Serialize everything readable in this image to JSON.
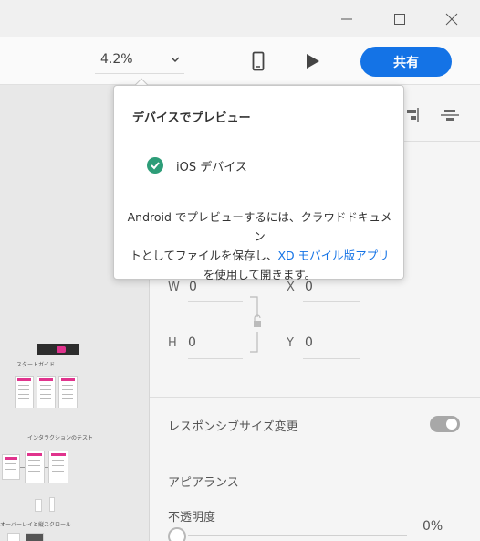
{
  "toolbar": {
    "zoom": "4.2%",
    "share_label": "共有"
  },
  "canvas": {
    "artboard_1_title": "スタートガイド",
    "artboard_2_title": "インタラクションのテスト",
    "artboard_3_title": "オーバーレイと縦スクロール"
  },
  "popover": {
    "title": "デバイスでプレビュー",
    "device_label": "iOS デバイス",
    "message_line1": "Android でプレビューするには、クラウドドキュメン",
    "message_line2_prefix": "トとしてファイルを保存し、",
    "message_link": "XD モバイル版アプリ",
    "message_line3": "を使用して開きます。"
  },
  "panel": {
    "w_label": "W",
    "w_value": "0",
    "x_label": "X",
    "x_value": "0",
    "h_label": "H",
    "h_value": "0",
    "y_label": "Y",
    "y_value": "0",
    "responsive_label": "レスポンシブサイズ変更",
    "appearance_label": "アピアランス",
    "opacity_label": "不透明度",
    "opacity_value": "0%"
  },
  "colors": {
    "accent": "#1473e6",
    "check": "#2d9d78",
    "pink": "#e0338d"
  },
  "icons": [
    "minimize-icon",
    "maximize-icon",
    "close-icon",
    "chevron-down-icon",
    "mobile-device-icon",
    "play-icon",
    "check-circle-icon",
    "link-proportion-icon",
    "align-right-icon",
    "align-center-icon"
  ]
}
